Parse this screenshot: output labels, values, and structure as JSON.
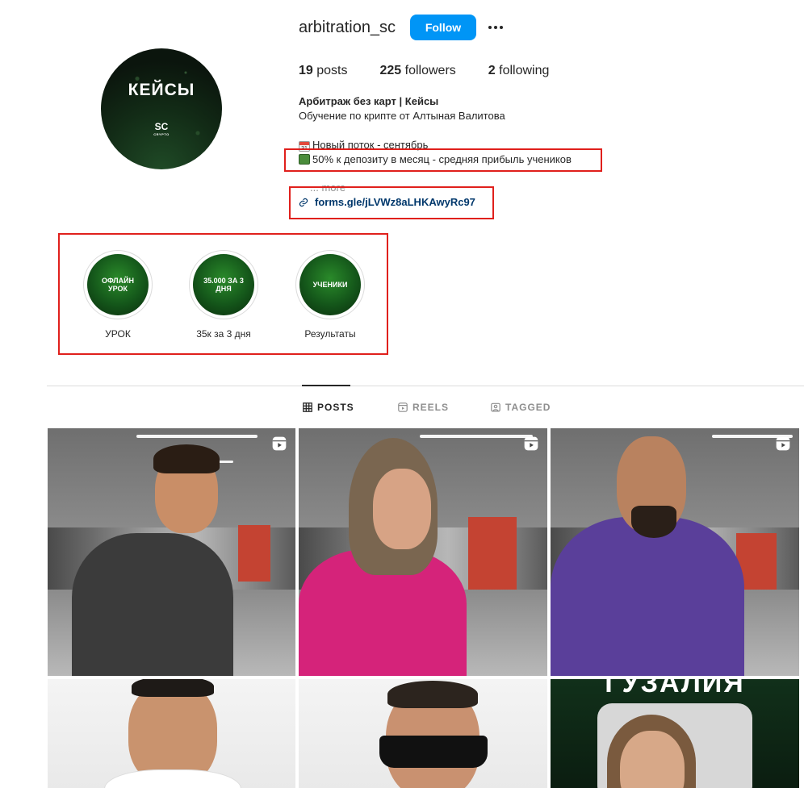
{
  "profile": {
    "username": "arbitration_sc",
    "follow_label": "Follow",
    "avatar_title": "КЕЙСЫ",
    "avatar_logo": "SC",
    "avatar_logo_sub": "CRYPTO"
  },
  "stats": {
    "posts_count": "19",
    "posts_label": " posts",
    "followers_count": "225",
    "followers_label": " followers",
    "following_count": "2",
    "following_label": " following"
  },
  "bio": {
    "name": "Арбитраж без карт | Кейсы",
    "line1": "Обучение по крипте от Алтыная Валитова",
    "line2": "Новый поток - сентябрь",
    "line3": "50% к депозиту в месяц - средняя прибыль учеников",
    "more": "... more",
    "link": "forms.gle/jLVWz8aLHKAwyRc97",
    "emoji_calendar_day": "31"
  },
  "highlights": [
    {
      "circle_text": "ОФЛАЙН УРОК",
      "label": "УРОК"
    },
    {
      "circle_text": "35.000 ЗА 3 ДНЯ",
      "label": "35к за 3 дня"
    },
    {
      "circle_text": "УЧЕНИКИ",
      "label": "Результаты"
    }
  ],
  "tabs": {
    "posts": "POSTS",
    "reels": "REELS",
    "tagged": "TAGGED"
  },
  "posts": {
    "overlay_title": "ГУЗАЛИЯ",
    "reel_icon": "reel-icon"
  },
  "colors": {
    "follow_button": "#0095f6",
    "link": "#00376b",
    "annotation_box": "#e0201c",
    "highlight_green": "#14561a"
  }
}
